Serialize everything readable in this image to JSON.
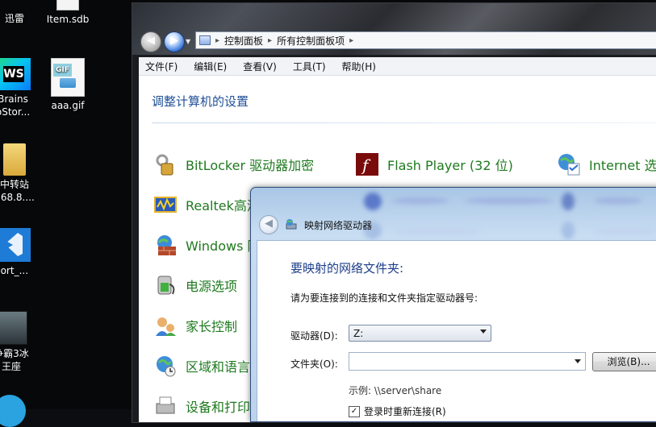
{
  "desktop": {
    "icons": [
      {
        "label": "迅雷"
      },
      {
        "label": "Item.sdb"
      },
      {
        "label_line1": "Brains",
        "label_line2": "oStor..."
      },
      {
        "label": "aaa.gif"
      },
      {
        "label_line1": "中转站",
        "label_line2": "168.8...."
      },
      {
        "label": "port_..."
      },
      {
        "label_line1": "争霸3冰",
        "label_line2": "王座"
      }
    ],
    "gif_badge": "GIF",
    "ws_badge": "WS"
  },
  "explorer": {
    "breadcrumb": [
      "控制面板",
      "所有控制面板项"
    ],
    "menu": [
      "文件(F)",
      "编辑(E)",
      "查看(V)",
      "工具(T)",
      "帮助(H)"
    ],
    "title": "调整计算机的设置",
    "items": [
      {
        "label": "BitLocker 驱动器加密",
        "icon": "bitlocker-icon"
      },
      {
        "label": "Flash Player (32 位)",
        "icon": "flash-icon"
      },
      {
        "label": "Internet 选",
        "icon": "internet-options-icon"
      },
      {
        "label": "Realtek高清",
        "icon": "realtek-audio-icon"
      },
      {
        "label": "Windows 防",
        "icon": "firewall-icon"
      },
      {
        "label": "电源选项",
        "icon": "power-icon"
      },
      {
        "label": "家长控制",
        "icon": "parental-control-icon"
      },
      {
        "label": "区域和语言",
        "icon": "region-language-icon"
      },
      {
        "label": "设备和打印",
        "icon": "printer-icon"
      }
    ]
  },
  "dialog": {
    "title": "映射网络驱动器",
    "heading": "要映射的网络文件夹:",
    "instruction": "请为要连接到的连接和文件夹指定驱动器号:",
    "drive_label": "驱动器(D):",
    "drive_value": "Z:",
    "folder_label": "文件夹(O):",
    "folder_value": "",
    "browse_label": "浏览(B)...",
    "example": "示例: \\\\server\\share",
    "reconnect_label": "登录时重新连接(R)",
    "reconnect_checked": true
  },
  "colors": {
    "link_green": "#1f7a1f",
    "heading_blue": "#1e3f8a",
    "cp_title_blue": "#1e4f95"
  }
}
